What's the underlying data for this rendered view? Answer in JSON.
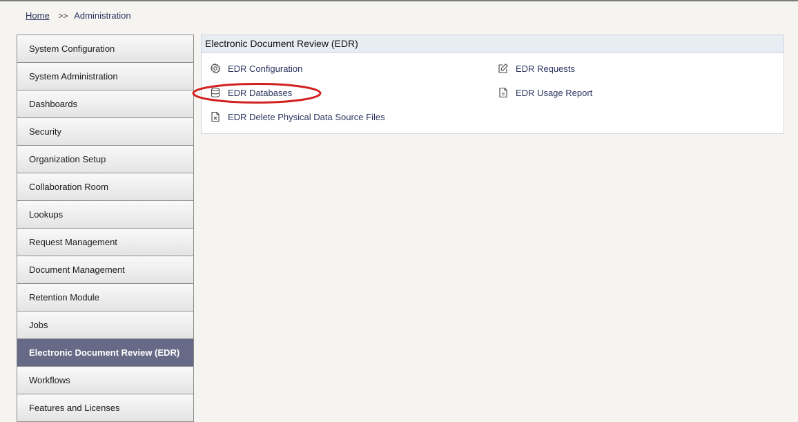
{
  "breadcrumb": {
    "home": "Home",
    "separator": ">>",
    "current": "Administration"
  },
  "sidebar": {
    "items": [
      {
        "label": "System Configuration"
      },
      {
        "label": "System Administration"
      },
      {
        "label": "Dashboards"
      },
      {
        "label": "Security"
      },
      {
        "label": "Organization Setup"
      },
      {
        "label": "Collaboration Room"
      },
      {
        "label": "Lookups"
      },
      {
        "label": "Request Management"
      },
      {
        "label": "Document Management"
      },
      {
        "label": "Retention Module"
      },
      {
        "label": "Jobs"
      },
      {
        "label": "Electronic Document Review (EDR)",
        "active": true
      },
      {
        "label": "Workflows"
      },
      {
        "label": "Features and Licenses"
      }
    ]
  },
  "panel": {
    "title": "Electronic Document Review (EDR)",
    "links": {
      "config": {
        "label": "EDR Configuration",
        "icon": "gear-icon"
      },
      "databases": {
        "label": "EDR Databases",
        "icon": "database-icon"
      },
      "delete_files": {
        "label": "EDR Delete Physical Data Source Files",
        "icon": "file-delete-icon"
      },
      "requests": {
        "label": "EDR Requests",
        "icon": "edit-icon"
      },
      "usage_report": {
        "label": "EDR Usage Report",
        "icon": "document-icon"
      }
    }
  },
  "colors": {
    "active_sidebar_bg": "#666a86",
    "link_color": "#2c3560",
    "highlight_ring": "#d21f1f"
  }
}
